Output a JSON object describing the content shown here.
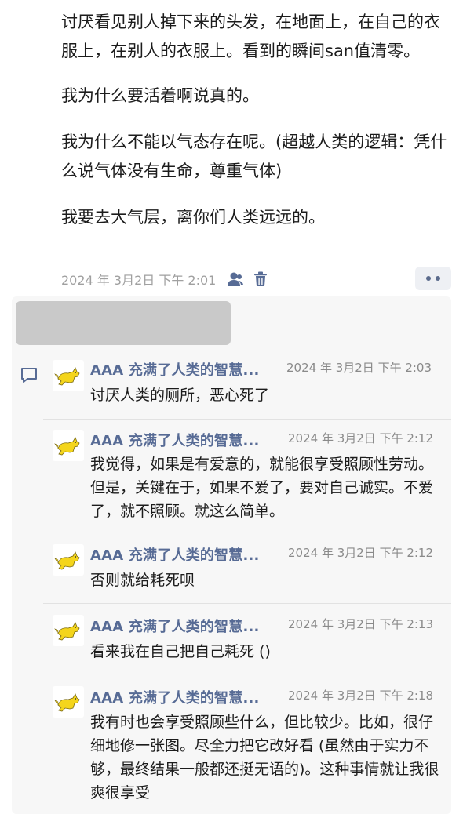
{
  "post": {
    "paragraphs": [
      "讨厌看见别人掉下来的头发，在地面上，在自己的衣服上，在别人的衣服上。看到的瞬间san值清零。",
      "我为什么要活着啊说真的。",
      "我为什么不能以气态存在呢。(超越人类的逻辑：凭什么说气体没有生命，尊重气体)",
      "我要去大气层，离你们人类远远的。"
    ],
    "date": "2024 年 3月2日 下午 2:01"
  },
  "icons": {
    "visibility": "person-icon",
    "delete": "trash-icon",
    "more": "more-dots-icon",
    "comment": "comment-icon",
    "avatar": "cat-avatar-icon"
  },
  "colors": {
    "username": "#576b95",
    "accent_icon": "#576b95",
    "comment_bg": "#f7f7f7"
  },
  "comments": [
    {
      "user": "AAA 充满了人类的智慧...",
      "time": "2024 年 3月2日 下午 2:03",
      "text": "讨厌人类的厕所，恶心死了"
    },
    {
      "user": "AAA 充满了人类的智慧...",
      "time": "2024 年 3月2日 下午 2:12",
      "text": "我觉得，如果是有爱意的，就能很享受照顾性劳动。但是，关键在于，如果不爱了，要对自己诚实。不爱了，就不照顾。就这么简单。"
    },
    {
      "user": "AAA 充满了人类的智慧...",
      "time": "2024 年 3月2日 下午 2:12",
      "text": "否则就给耗死呗"
    },
    {
      "user": "AAA 充满了人类的智慧...",
      "time": "2024 年 3月2日 下午 2:13",
      "text": "看来我在自己把自己耗死 ()"
    },
    {
      "user": "AAA 充满了人类的智慧...",
      "time": "2024 年 3月2日 下午 2:18",
      "text": "我有时也会享受照顾些什么，但比较少。比如，很仔细地修一张图。尽全力把它改好看 (虽然由于实力不够，最终结果一般都还挺无语的)。这种事情就让我很爽很享受"
    }
  ]
}
